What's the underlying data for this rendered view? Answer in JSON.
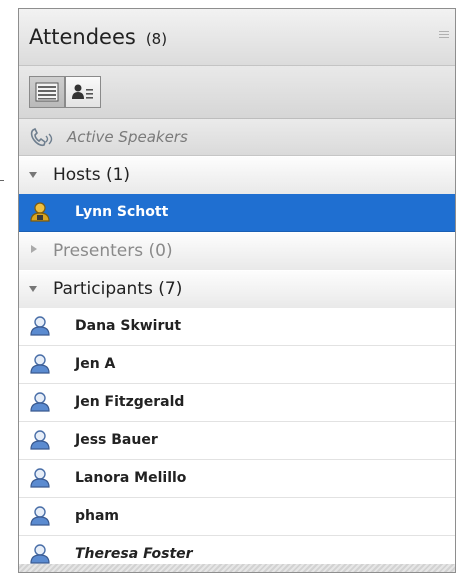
{
  "panel": {
    "title": "Attendees",
    "count": "(8)"
  },
  "toolbar": {
    "list_view_icon": "list-view-icon",
    "detail_view_icon": "attendee-detail-view-icon"
  },
  "speakers": {
    "icon": "phone-speaker-icon",
    "label": "Active Speakers"
  },
  "groups": [
    {
      "label": "Hosts (1)",
      "expanded": true
    },
    {
      "label": "Presenters (0)",
      "expanded": false
    },
    {
      "label": "Participants (7)",
      "expanded": true
    }
  ],
  "hosts": [
    {
      "name": "Lynn Schott",
      "selected": true,
      "icon": "host-user-icon"
    }
  ],
  "participants": [
    {
      "name": "Dana Skwirut",
      "icon": "participant-user-icon"
    },
    {
      "name": "Jen A",
      "icon": "participant-user-icon"
    },
    {
      "name": "Jen Fitzgerald",
      "icon": "participant-user-icon"
    },
    {
      "name": "Jess Bauer",
      "icon": "participant-user-icon"
    },
    {
      "name": "Lanora Melillo",
      "icon": "participant-user-icon"
    },
    {
      "name": "pham",
      "icon": "participant-user-icon"
    },
    {
      "name": "Theresa Foster",
      "icon": "participant-user-icon",
      "italic": true
    }
  ],
  "colors": {
    "selected_row": "#1f6fd1",
    "host_icon": "#d9a521",
    "participant_icon": "#5b8bd0"
  }
}
